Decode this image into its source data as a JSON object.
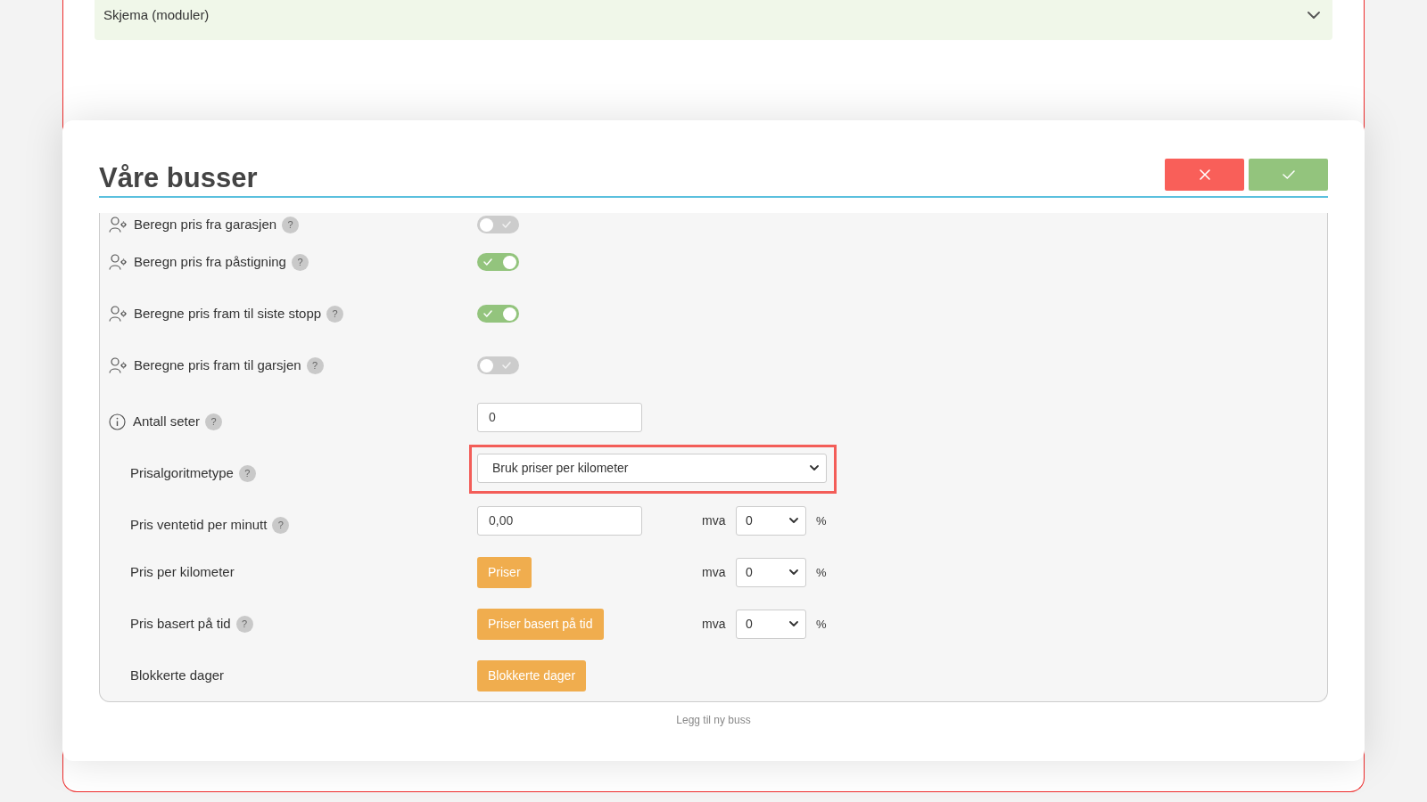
{
  "form_section": {
    "title": "Skjema (moduler)",
    "expanded": false
  },
  "dialog": {
    "title": "Våre busser",
    "actions": [
      {
        "kind": "cancel"
      },
      {
        "kind": "confirm"
      }
    ],
    "rows": [
      {
        "kind": "toggle",
        "label": "Beregn pris fra garasjen",
        "help": "?",
        "on": false
      },
      {
        "kind": "toggle",
        "label": "Beregn pris fra påstigning",
        "help": "?",
        "on": true
      },
      {
        "kind": "toggle",
        "label": "Beregne pris fram til siste stopp",
        "help": "?",
        "on": true
      },
      {
        "kind": "toggle",
        "label": "Beregne pris fram til garsjen",
        "help": "?",
        "on": false
      },
      {
        "kind": "counter",
        "label": "Antall seter",
        "help": "?",
        "value": "0"
      },
      {
        "kind": "dropdown",
        "label": "Prisalgoritmetype",
        "help": "?",
        "value": "Bruk priser per kilometer",
        "highlighted": true
      },
      {
        "kind": "rate",
        "label": "Pris ventetid per minutt",
        "help": "?",
        "value": "0,00",
        "vat": {
          "label": "mva",
          "value": "0",
          "unit": "%"
        }
      },
      {
        "kind": "pricing",
        "label": "Pris per kilometer",
        "button": "Priser",
        "vat": {
          "label": "mva",
          "value": "0",
          "unit": "%"
        }
      },
      {
        "kind": "pricing",
        "label": "Pris basert på tid",
        "help": "?",
        "button": "Priser basert på tid",
        "vat": {
          "label": "mva",
          "value": "0",
          "unit": "%"
        }
      },
      {
        "kind": "action",
        "label": "Blokkerte dager",
        "button": "Blokkerte dager"
      }
    ],
    "footer_link": "Legg til ny buss"
  }
}
